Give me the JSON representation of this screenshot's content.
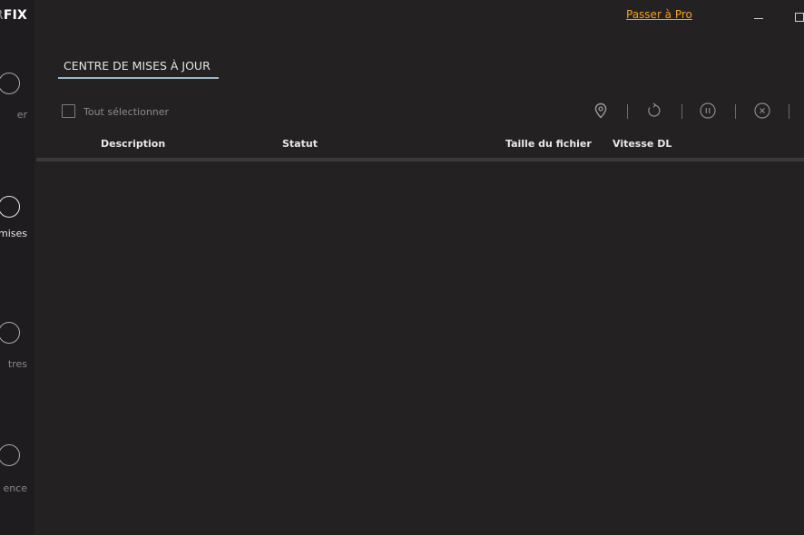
{
  "sidebar": {
    "brand_prefix": "R",
    "brand_suffix": "FIX",
    "items": [
      {
        "label": "er"
      },
      {
        "label": "mises",
        "active": true
      },
      {
        "label": "tres"
      },
      {
        "label": "ence"
      }
    ]
  },
  "header": {
    "upgrade_link": "Passer à Pro"
  },
  "main": {
    "tab_label": "CENTRE DE MISES À JOUR",
    "select_all_label": "Tout sélectionner",
    "columns": {
      "description": "Description",
      "status": "Statut",
      "file_size": "Taille du fichier",
      "dl_speed": "Vitesse DL"
    },
    "rows": []
  },
  "colors": {
    "background": "#242123",
    "sidebar": "#1e1c1e",
    "accent_link": "#f4a21f",
    "tab_underline": "#9fb6c6"
  },
  "icons": [
    "location-pin-icon",
    "refresh-icon",
    "pause-icon",
    "cancel-icon"
  ]
}
